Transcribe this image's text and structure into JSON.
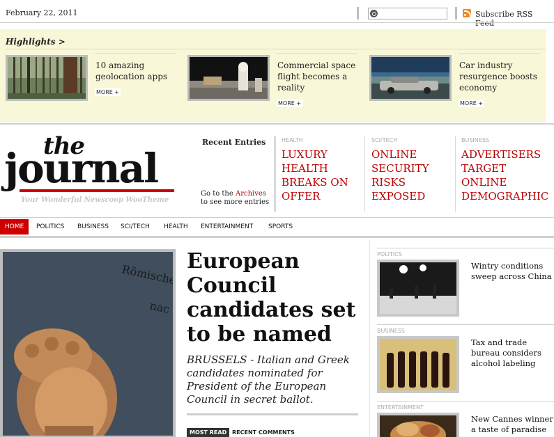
{
  "topbar": {
    "date": "February 22, 2011",
    "search_placeholder": "",
    "rss_label": "Subscribe RSS Feed",
    "rss_icon": "rss-icon",
    "search_icon": "search-icon"
  },
  "highlights": {
    "title": "Highlights >",
    "items": [
      {
        "text": "10 amazing geolocation apps",
        "more": "MORE +"
      },
      {
        "text": "Commercial space flight becomes a reality",
        "more": "MORE +"
      },
      {
        "text": "Car industry resurgence boosts economy",
        "more": "MORE +"
      }
    ]
  },
  "header": {
    "logo_the": "the",
    "logo_journal": "journal",
    "tagline": "Your Wonderful Newscoop WooTheme",
    "recent_title": "Recent Entries",
    "archives_pre": "Go to the ",
    "archives_link": "Archives",
    "archives_post": "to see more entries",
    "sections": [
      {
        "category": "HEALTH",
        "headline": "LUXURY HEALTH BREAKS ON OFFER"
      },
      {
        "category": "SCI/TECH",
        "headline": "ONLINE SECURITY RISKS EXPOSED"
      },
      {
        "category": "BUSINESS",
        "headline": "ADVERTISERS TARGET ONLINE DEMOGRAPHIC"
      }
    ]
  },
  "nav": {
    "items": [
      "HOME",
      "POLITICS",
      "BUSINESS",
      "SCI/TECH",
      "HEALTH",
      "ENTERTAINMENT",
      "SPORTS"
    ],
    "active": "HOME"
  },
  "main": {
    "headline": "European Council candidates set to be named",
    "summary": "BRUSSELS - Italian and Greek candidates nominated for President of the European Council in secret ballot.",
    "tab_most_read": "MOST READ",
    "tab_recent_comments": "RECENT COMMENTS"
  },
  "sidebar": {
    "items": [
      {
        "category": "POLITICS",
        "text": "Wintry conditions sweep across China"
      },
      {
        "category": "BUSINESS",
        "text": "Tax and trade bureau considers alcohol labeling"
      },
      {
        "category": "ENTERTAINMENT",
        "text": "New Cannes winner a taste of paradise"
      }
    ]
  },
  "colors": {
    "accent": "#cc0000",
    "highlight_bg": "#f8f8d8",
    "rss": "#f08a24"
  }
}
